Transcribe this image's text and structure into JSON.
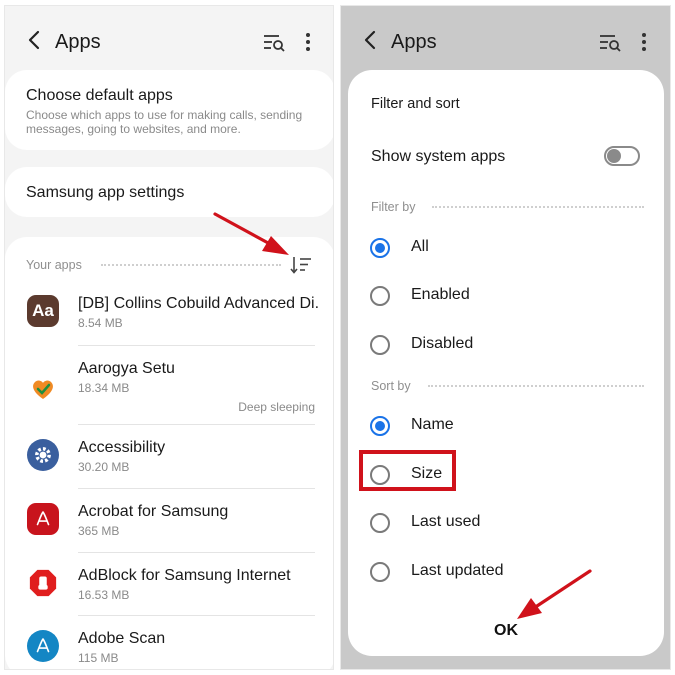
{
  "left_screen": {
    "header": {
      "title": "Apps",
      "back_icon": "back-arrow-icon",
      "search_icon": "filter-search-icon",
      "more_icon": "more-vertical-icon"
    },
    "default_apps": {
      "title": "Choose default apps",
      "subtitle": "Choose which apps to use for making calls, sending messages, going to websites, and more."
    },
    "samsung_settings": {
      "title": "Samsung app settings"
    },
    "your_apps": {
      "label": "Your apps",
      "sort_icon": "sort-icon"
    },
    "apps": [
      {
        "name": "[DB] Collins Cobuild Advanced Di...",
        "size": "8.54 MB",
        "status": "",
        "icon": "collins-dictionary-icon",
        "icon_text": "Aa",
        "color": "#5b3a2e"
      },
      {
        "name": "Aarogya Setu",
        "size": "18.34 MB",
        "status": "Deep sleeping",
        "icon": "aarogya-setu-heart-icon",
        "color": "#f08a24"
      },
      {
        "name": "Accessibility",
        "size": "30.20 MB",
        "status": "",
        "icon": "accessibility-gear-icon",
        "color": "#3a5f9e"
      },
      {
        "name": "Acrobat for Samsung",
        "size": "365 MB",
        "status": "",
        "icon": "acrobat-icon",
        "color": "#c8141d"
      },
      {
        "name": "AdBlock for Samsung Internet",
        "size": "16.53 MB",
        "status": "",
        "icon": "adblock-hand-icon",
        "color": "#e01e1e"
      },
      {
        "name": "Adobe Scan",
        "size": "115 MB",
        "status": "",
        "icon": "adobe-scan-icon",
        "color": "#1486c4"
      }
    ]
  },
  "right_screen": {
    "header": {
      "title": "Apps"
    },
    "dialog": {
      "title": "Filter and sort",
      "show_system_apps": {
        "label": "Show system apps",
        "enabled": false
      },
      "filter_by": {
        "label": "Filter by",
        "options": [
          "All",
          "Enabled",
          "Disabled"
        ],
        "selected": "All"
      },
      "sort_by": {
        "label": "Sort by",
        "options": [
          "Name",
          "Size",
          "Last used",
          "Last updated"
        ],
        "selected": "Name"
      },
      "ok_label": "OK"
    }
  },
  "annotations": {
    "arrow_color": "#d0121b",
    "highlight_target": "Size"
  },
  "colors": {
    "accent": "#1a73e8",
    "background": "#f4f4f4"
  }
}
